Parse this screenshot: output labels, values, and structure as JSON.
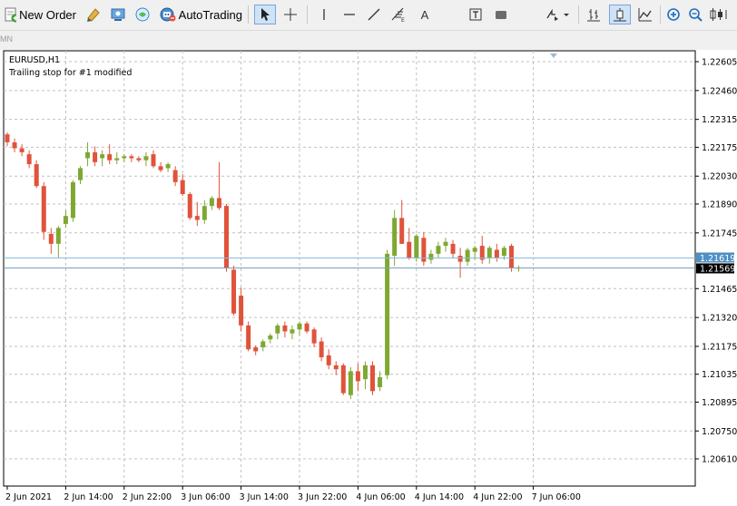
{
  "toolbar": {
    "new_order_label": "New Order",
    "autotrading_label": "AutoTrading",
    "text_tool_label": "A",
    "icons": [
      "new-order-icon",
      "metaeditor-icon",
      "navigator-icon",
      "market-watch-icon",
      "autotrading-icon",
      "cursor-icon",
      "crosshair-icon",
      "vertical-line-icon",
      "horizontal-line-icon",
      "trendline-icon",
      "fibonacci-icon",
      "text-icon",
      "text-label-icon",
      "rectangle-icon",
      "arrows-icon",
      "bar-chart-icon",
      "candlestick-icon",
      "line-chart-icon",
      "zoom-in-icon",
      "zoom-out-icon"
    ]
  },
  "timeframes": {
    "visible": "MN"
  },
  "chart_data": {
    "type": "candlestick",
    "symbol_label": "EURUSD,H1",
    "status_message": "Trailing stop for #1 modified",
    "y_ticks": [
      "1.22605",
      "1.22460",
      "1.22315",
      "1.22175",
      "1.22030",
      "1.21890",
      "1.21745",
      "1.21465",
      "1.21320",
      "1.21175",
      "1.21035",
      "1.20895",
      "1.20750",
      "1.20610"
    ],
    "y_tick_values": [
      1.22605,
      1.2246,
      1.22315,
      1.22175,
      1.2203,
      1.2189,
      1.21745,
      1.21465,
      1.2132,
      1.21175,
      1.21035,
      1.20895,
      1.2075,
      1.2061
    ],
    "ylim": [
      1.2061,
      1.22605
    ],
    "x_tick_labels": [
      "2 Jun 2021",
      "2 Jun 14:00",
      "2 Jun 22:00",
      "3 Jun 06:00",
      "3 Jun 14:00",
      "3 Jun 22:00",
      "4 Jun 06:00",
      "4 Jun 14:00",
      "4 Jun 22:00",
      "7 Jun 06:00"
    ],
    "bars_per_label": 8,
    "ask_line": {
      "label": "1.21619",
      "value": 1.21619,
      "color": "#4f8fc4"
    },
    "bid_line": {
      "label": "1.21569",
      "value": 1.21569,
      "color": "#000000"
    },
    "colors": {
      "bull": "#7ea832",
      "bear": "#e0533b",
      "grid": "#c0c0c0",
      "ask": "#85bcdf",
      "bid": "#7aa2c2"
    },
    "grid": true,
    "candles": [
      [
        1.2224,
        1.2225,
        1.2218,
        1.222
      ],
      [
        1.222,
        1.2222,
        1.2215,
        1.2217
      ],
      [
        1.2217,
        1.2219,
        1.2213,
        1.2215
      ],
      [
        1.2214,
        1.2216,
        1.2207,
        1.2209
      ],
      [
        1.2209,
        1.2211,
        1.2197,
        1.2198
      ],
      [
        1.2198,
        1.22,
        1.2171,
        1.2175
      ],
      [
        1.2174,
        1.2177,
        1.2164,
        1.2169
      ],
      [
        1.2169,
        1.2178,
        1.2162,
        1.2177
      ],
      [
        1.2179,
        1.2186,
        1.2177,
        1.2183
      ],
      [
        1.2182,
        1.2201,
        1.218,
        1.22
      ],
      [
        1.2201,
        1.2208,
        1.2199,
        1.2207
      ],
      [
        1.2212,
        1.222,
        1.2208,
        1.2215
      ],
      [
        1.2215,
        1.2218,
        1.2208,
        1.221
      ],
      [
        1.2212,
        1.2216,
        1.2208,
        1.2214
      ],
      [
        1.2214,
        1.2219,
        1.2209,
        1.2211
      ],
      [
        1.2211,
        1.2215,
        1.2209,
        1.2212
      ],
      [
        1.2212,
        1.2214,
        1.221,
        1.2213
      ],
      [
        1.2213,
        1.2214,
        1.221,
        1.2212
      ],
      [
        1.2212,
        1.2213,
        1.221,
        1.2211
      ],
      [
        1.2211,
        1.2215,
        1.2208,
        1.2213
      ],
      [
        1.2214,
        1.2216,
        1.2207,
        1.2208
      ],
      [
        1.2208,
        1.221,
        1.2205,
        1.2206
      ],
      [
        1.2207,
        1.221,
        1.2205,
        1.2209
      ],
      [
        1.2206,
        1.2208,
        1.2198,
        1.22
      ],
      [
        1.2201,
        1.2204,
        1.2193,
        1.2194
      ],
      [
        1.2194,
        1.2195,
        1.2181,
        1.2182
      ],
      [
        1.2183,
        1.219,
        1.2178,
        1.2181
      ],
      [
        1.2181,
        1.2191,
        1.2179,
        1.2188
      ],
      [
        1.2188,
        1.2193,
        1.2186,
        1.2192
      ],
      [
        1.2192,
        1.221,
        1.2186,
        1.2187
      ],
      [
        1.2188,
        1.2189,
        1.2155,
        1.2157
      ],
      [
        1.2156,
        1.2158,
        1.2133,
        1.2134
      ],
      [
        1.2143,
        1.2147,
        1.2125,
        1.2128
      ],
      [
        1.2128,
        1.213,
        1.2115,
        1.2116
      ],
      [
        1.2117,
        1.2118,
        1.2113,
        1.2115
      ],
      [
        1.2117,
        1.2121,
        1.2115,
        1.212
      ],
      [
        1.2121,
        1.2124,
        1.2119,
        1.2123
      ],
      [
        1.2124,
        1.2129,
        1.2121,
        1.2128
      ],
      [
        1.2128,
        1.213,
        1.2122,
        1.2125
      ],
      [
        1.2124,
        1.2128,
        1.2121,
        1.2126
      ],
      [
        1.2126,
        1.213,
        1.2123,
        1.2129
      ],
      [
        1.2129,
        1.213,
        1.2124,
        1.2125
      ],
      [
        1.2126,
        1.2127,
        1.2117,
        1.2119
      ],
      [
        1.212,
        1.2122,
        1.211,
        1.2112
      ],
      [
        1.2113,
        1.2116,
        1.2106,
        1.2108
      ],
      [
        1.2108,
        1.211,
        1.2103,
        1.2106
      ],
      [
        1.2108,
        1.2109,
        1.2093,
        1.2094
      ],
      [
        1.2093,
        1.2107,
        1.2091,
        1.2105
      ],
      [
        1.2105,
        1.2109,
        1.2095,
        1.21
      ],
      [
        1.2101,
        1.211,
        1.2096,
        1.2108
      ],
      [
        1.2108,
        1.211,
        1.2093,
        1.2095
      ],
      [
        1.2097,
        1.2105,
        1.2095,
        1.2102
      ],
      [
        1.2103,
        1.2166,
        1.2101,
        1.2164
      ],
      [
        1.2163,
        1.2186,
        1.2158,
        1.2182
      ],
      [
        1.2182,
        1.2191,
        1.2169,
        1.2169
      ],
      [
        1.217,
        1.2177,
        1.2161,
        1.2162
      ],
      [
        1.2162,
        1.2174,
        1.216,
        1.2173
      ],
      [
        1.2172,
        1.2175,
        1.2158,
        1.216
      ],
      [
        1.2161,
        1.2166,
        1.2159,
        1.2164
      ],
      [
        1.2164,
        1.217,
        1.2162,
        1.2168
      ],
      [
        1.2168,
        1.2172,
        1.2165,
        1.217
      ],
      [
        1.2169,
        1.2171,
        1.2162,
        1.2164
      ],
      [
        1.2163,
        1.2167,
        1.2152,
        1.216
      ],
      [
        1.216,
        1.2167,
        1.2158,
        1.2166
      ],
      [
        1.2165,
        1.2168,
        1.2161,
        1.2167
      ],
      [
        1.2168,
        1.2173,
        1.2159,
        1.2161
      ],
      [
        1.2162,
        1.2168,
        1.2159,
        1.2167
      ],
      [
        1.2166,
        1.2169,
        1.216,
        1.2162
      ],
      [
        1.2163,
        1.2168,
        1.2161,
        1.2167
      ],
      [
        1.2168,
        1.2169,
        1.2155,
        1.2157
      ],
      [
        1.2157,
        1.2158,
        1.2155,
        1.2157
      ]
    ]
  }
}
